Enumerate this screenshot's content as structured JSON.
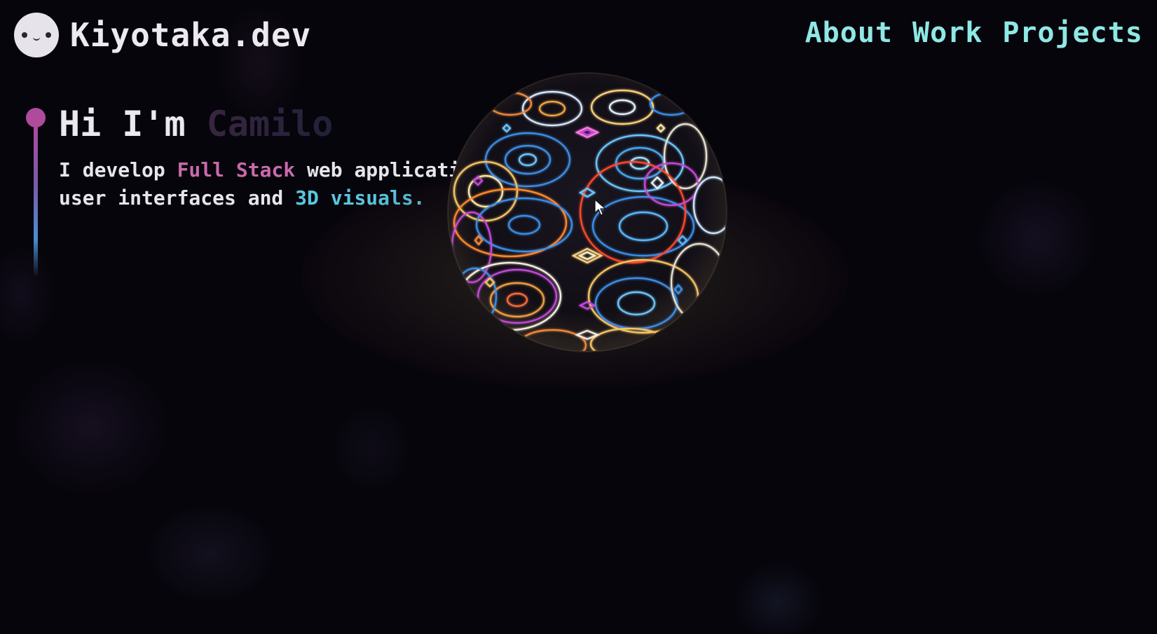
{
  "header": {
    "brand": "Kiyotaka.dev",
    "nav": [
      {
        "label": "About"
      },
      {
        "label": "Work"
      },
      {
        "label": "Projects"
      }
    ]
  },
  "intro": {
    "greeting_prefix": "Hi I'm",
    "name": "Camilo",
    "line1_a": "I develop ",
    "line1_highlight": "Full Stack",
    "line1_b": " web applications,",
    "line2_a": "user interfaces and ",
    "line2_highlight": "3D visuals."
  },
  "colors": {
    "nav": "#8fe8e4",
    "accent_pink": "#c96aab",
    "accent_cyan": "#58c7e0",
    "timeline_dot": "#b04a9c"
  },
  "icons": {
    "avatar": "kawaii-face-icon",
    "cursor": "mouse-pointer-icon"
  }
}
